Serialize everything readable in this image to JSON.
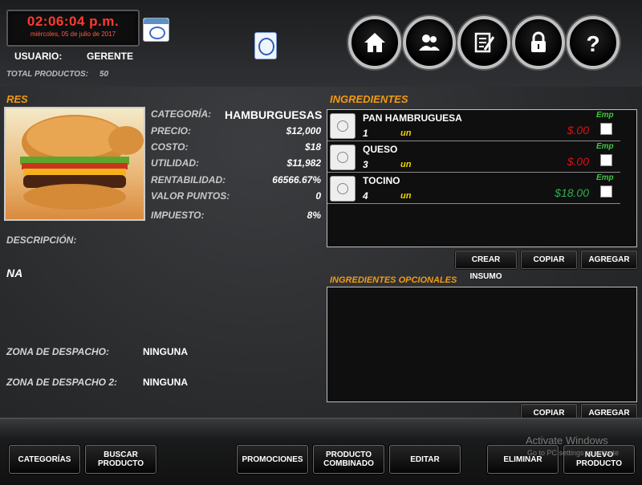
{
  "header": {
    "clock_time": "02:06:04 p.m.",
    "clock_date": "miércoles, 05 de julio de 2017",
    "user_label": "USUARIO:",
    "user_value": "GERENTE",
    "total_label": "TOTAL PRODUCTOS:",
    "total_value": "50",
    "nav_icons": [
      "home-icon",
      "users-icon",
      "notes-icon",
      "lock-icon",
      "help-icon"
    ]
  },
  "product": {
    "name": "RES",
    "image": "hamburger-photo",
    "fields": {
      "categoria_label": "CATEGORÍA:",
      "categoria_value": "HAMBURGUESAS",
      "precio_label": "PRECIO:",
      "precio_value": "$12,000",
      "costo_label": "COSTO:",
      "costo_value": "$18",
      "utilidad_label": "UTILIDAD:",
      "utilidad_value": "$11,982",
      "rentabilidad_label": "RENTABILIDAD:",
      "rentabilidad_value": "66566.67%",
      "valor_puntos_label": "VALOR PUNTOS:",
      "valor_puntos_value": "0",
      "impuesto_label": "IMPUESTO:",
      "impuesto_value": "8%"
    },
    "descripcion_label": "DESCRIPCIÓN:",
    "descripcion_value": "NA",
    "zona1_label": "ZONA DE DESPACHO:",
    "zona1_value": "NINGUNA",
    "zona2_label": "ZONA DE DESPACHO 2:",
    "zona2_value": "NINGUNA"
  },
  "ingredientes": {
    "title": "INGREDIENTES",
    "emp_label": "Emp",
    "items": [
      {
        "name": "PAN HAMBRUGUESA",
        "qty": "1",
        "unit": "un",
        "price": "$.00",
        "price_color": "#e01010",
        "checked": false
      },
      {
        "name": "QUESO",
        "qty": "3",
        "unit": "un",
        "price": "$.00",
        "price_color": "#e01010",
        "checked": false
      },
      {
        "name": "TOCINO",
        "qty": "4",
        "unit": "un",
        "price": "$18.00",
        "price_color": "#2fb04a",
        "checked": false
      }
    ],
    "buttons": {
      "crear_insumo": "CREAR INSUMO",
      "copiar": "COPIAR",
      "agregar": "AGREGAR"
    }
  },
  "opcionales": {
    "title": "INGREDIENTES OPCIONALES",
    "buttons": {
      "copiar": "COPIAR",
      "agregar": "AGREGAR"
    }
  },
  "footer": {
    "categorias": "CATEGORÍAS",
    "buscar_producto": "BUSCAR PRODUCTO",
    "promociones": "PROMOCIONES",
    "producto_combinado": "PRODUCTO COMBINADO",
    "editar": "EDITAR",
    "eliminar": "ELIMINAR",
    "nuevo_producto": "NUEVO PRODUCTO"
  },
  "watermark": {
    "line1": "Activate Windows",
    "line2": "Go to PC settings to activate"
  },
  "colors": {
    "accent_orange": "#f39a13",
    "clock_red": "#ff3b2f",
    "unit_yellow": "#f2d400",
    "emp_green": "#3ec93e"
  }
}
